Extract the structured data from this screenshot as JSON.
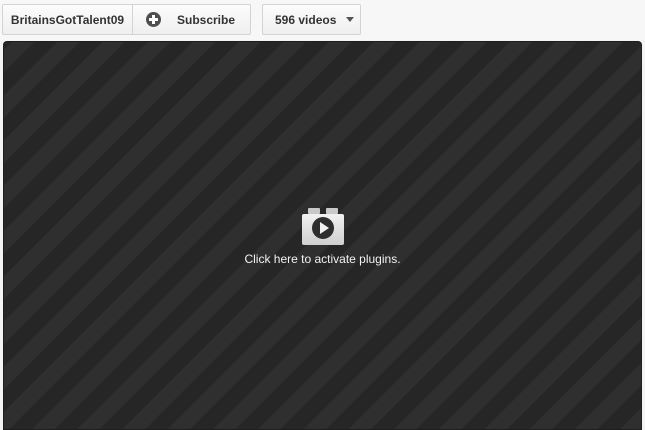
{
  "toolbar": {
    "channel_name": "BritainsGotTalent09",
    "subscribe_label": "Subscribe",
    "videos_label": "596 videos",
    "icons": {
      "subscribe": "plus-circle-icon",
      "videos": "caret-down-icon"
    }
  },
  "player": {
    "plugin_message": "Click here to activate plugins.",
    "icon": "plugin-play-icon"
  },
  "colors": {
    "player_background": "#2a2a2a",
    "toolbar_background": "#f7f7f7"
  }
}
